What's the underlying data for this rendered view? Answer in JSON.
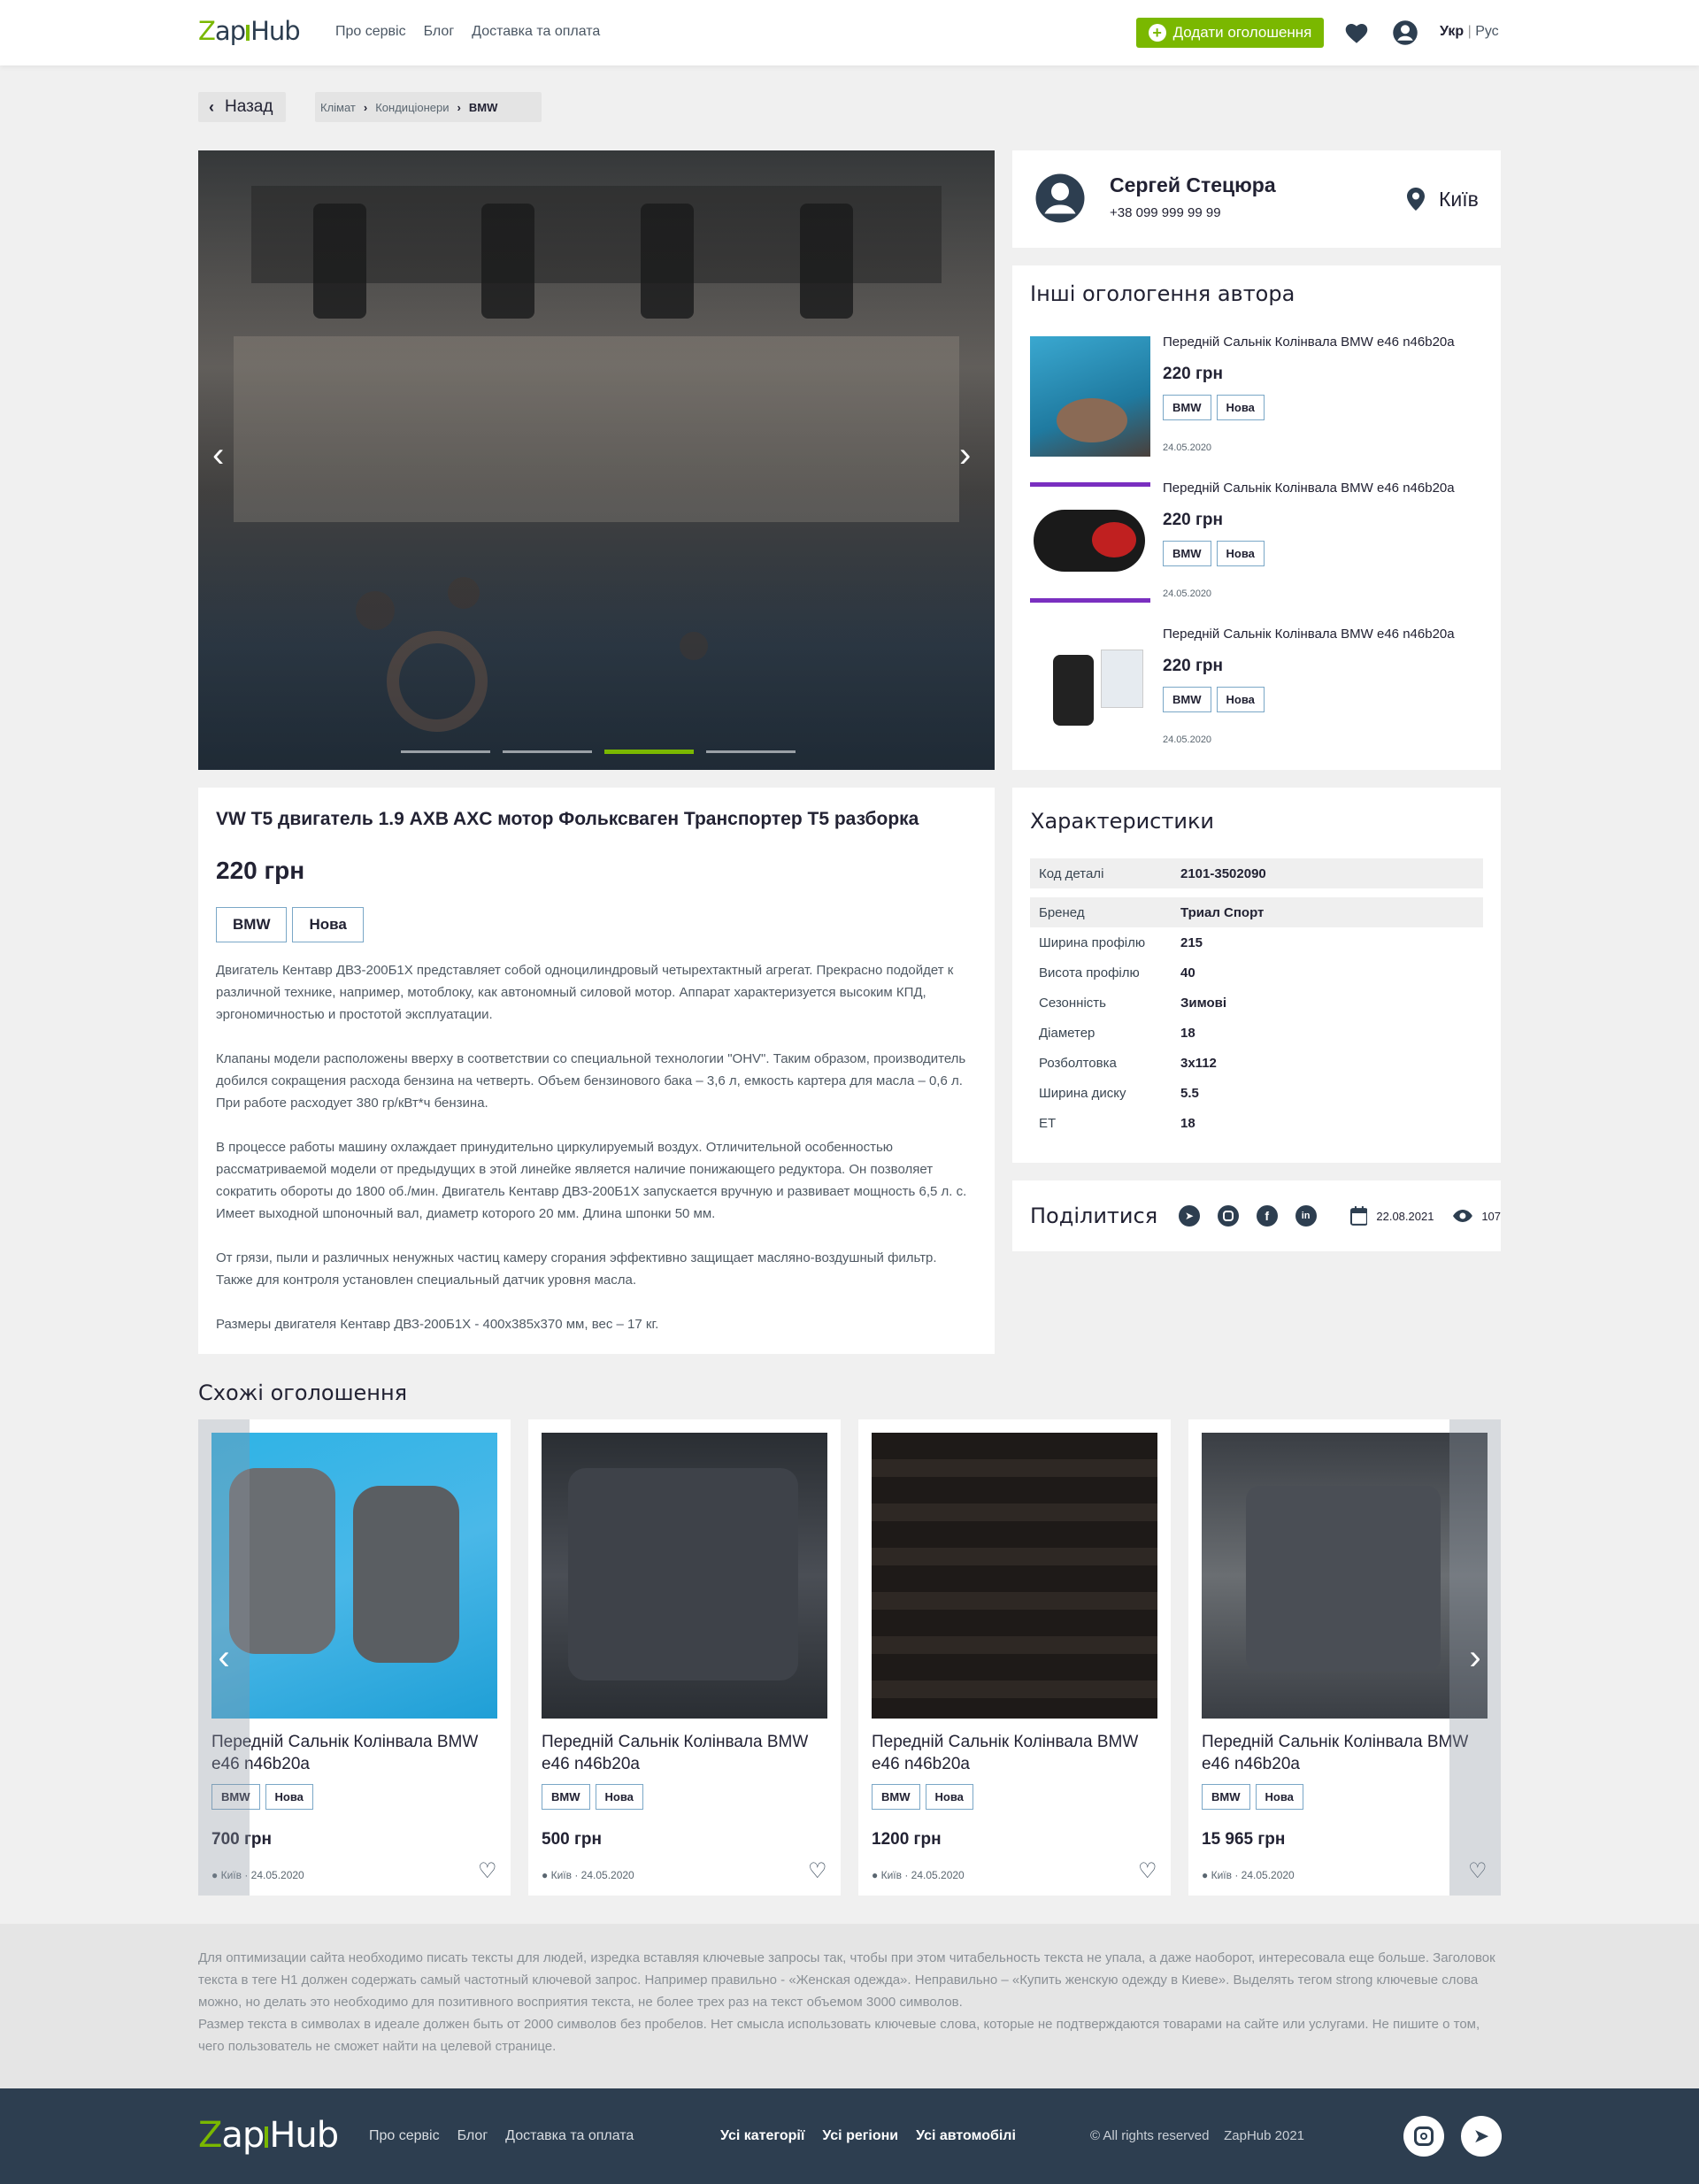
{
  "header": {
    "logo": "ZapHub",
    "nav": [
      "Про сервіс",
      "Блог",
      "Доставка та оплата"
    ],
    "add_button": "Додати оголошення",
    "lang_ukr": "Укр",
    "lang_rus": "Рус"
  },
  "breadcrumb": {
    "back": "Назад",
    "items": [
      "Клімат",
      "Кондиціонери",
      "BMW"
    ]
  },
  "gallery": {
    "slides": 4,
    "active_slide": 3
  },
  "seller": {
    "name": "Сергей Стецюра",
    "phone": "+38 099 999 99 99",
    "city": "Київ"
  },
  "other_ads": {
    "title": "Інші огологення автора",
    "items": [
      {
        "title": "Передній Сальнік Колінвала BMW e46 n46b20a",
        "price": "220 грн",
        "tags": [
          "BMW",
          "Нова"
        ],
        "date": "24.05.2020"
      },
      {
        "title": "Передній Сальнік Колінвала BMW e46 n46b20a",
        "price": "220 грн",
        "tags": [
          "BMW",
          "Нова"
        ],
        "date": "24.05.2020"
      },
      {
        "title": "Передній Сальнік Колінвала BMW e46 n46b20a",
        "price": "220 грн",
        "tags": [
          "BMW",
          "Нова"
        ],
        "date": "24.05.2020"
      }
    ]
  },
  "product": {
    "title": "VW T5 двигатель 1.9 AXB AXC мотор Фольксваген Транспортер Т5 разборка",
    "price": "220 грн",
    "tags": [
      "BMW",
      "Нова"
    ],
    "description": [
      "Двигатель Кентавр ДВЗ-200Б1Х представляет собой одноцилиндровый четырехтактный агрегат. Прекрасно подойдет к различной технике, например, мотоблоку, как автономный силовой мотор. Аппарат характеризуется высоким КПД, эргономичностью и простотой эксплуатации.",
      "Клапаны модели расположены вверху в соответствии со специальной технологии \"OHV\". Таким образом, производитель добился сокращения расхода бензина на четверть. Объем бензинового бака – 3,6 л, емкость картера для масла – 0,6 л. При работе расходует 380 гр/кВт*ч бензина.",
      "В процессе работы машину охлаждает принудительно циркулируемый воздух. Отличительной особенностью рассматриваемой модели от предыдущих в этой линейке является наличие понижающего редуктора. Он позволяет сократить обороты до 1800 об./мин. Двигатель Кентавр ДВЗ-200Б1Х запускается вручную и развивает мощность 6,5 л. с. Имеет выходной шпоночный вал, диаметр которого 20 мм. Длина шпонки 50 мм.",
      "От грязи, пыли и различных ненужных частиц камеру сгорания эффективно защищает масляно-воздушный фильтр. Также для контроля установлен специальный датчик уровня масла.",
      "Размеры двигателя Кентавр ДВЗ-200Б1Х - 400х385х370 мм, вес – 17 кг."
    ]
  },
  "specs": {
    "title": "Характеристики",
    "rows": [
      {
        "key": "Код деталі",
        "value": "2101-3502090"
      },
      {
        "key": "Бренед",
        "value": "Триал Спорт"
      },
      {
        "key": "Ширина профілю",
        "value": "215"
      },
      {
        "key": "Висота профілю",
        "value": "40"
      },
      {
        "key": "Сезонність",
        "value": "Зимові"
      },
      {
        "key": "Діаметер",
        "value": "18"
      },
      {
        "key": "Розболтовка",
        "value": "3х112"
      },
      {
        "key": "Ширина диску",
        "value": "5.5"
      },
      {
        "key": "ЕТ",
        "value": "18"
      }
    ]
  },
  "share": {
    "title": "Поділитися",
    "date": "22.08.2021",
    "views": "107"
  },
  "similar": {
    "title": "Схожі оголошення",
    "items": [
      {
        "title": "Передній Сальнік Колінвала BMW e46 n46b20a",
        "tags": [
          "BMW",
          "Нова"
        ],
        "price": "700 грн",
        "city": "Київ",
        "date": "24.05.2020"
      },
      {
        "title": "Передній Сальнік Колінвала BMW e46 n46b20a",
        "tags": [
          "BMW",
          "Нова"
        ],
        "price": "500 грн",
        "city": "Київ",
        "date": "24.05.2020"
      },
      {
        "title": "Передній Сальнік Колінвала BMW e46 n46b20a",
        "tags": [
          "BMW",
          "Нова"
        ],
        "price": "1200 грн",
        "city": "Київ",
        "date": "24.05.2020"
      },
      {
        "title": "Передній Сальнік Колінвала BMW e46 n46b20a",
        "tags": [
          "BMW",
          "Нова"
        ],
        "price": "15 965 грн",
        "city": "Київ",
        "date": "24.05.2020"
      }
    ]
  },
  "seo_text": [
    "Для оптимизации сайта необходимо писать тексты для людей, изредка вставляя ключевые запросы так, чтобы при этом читабельность текста не упала, а даже наоборот, интересовала еще больше. Заголовок текста в теге H1 должен содержать самый частотный ключевой запрос. Например правильно - «Женская одежда». Неправильно – «Купить женскую одежду в Киеве». Выделять тегом strong ключевые слова можно, но делать это необходимо для позитивного восприятия текста, не более трех раз на текст объемом 3000 символов.",
    "Размер текста в символах в идеале должен быть от 2000 символов без пробелов. Нет смысла использовать ключевые слова, которые не подтверждаются товарами на сайте или услугами. Не пишите о том, чего пользователь не сможет найти на целевой странице."
  ],
  "footer": {
    "logo": "ZapHub",
    "nav": [
      "Про сервіс",
      "Блог",
      "Доставка та оплата"
    ],
    "cats": [
      "Усі категорії",
      "Усі регіони",
      "Усі автомобілі"
    ],
    "rights": "© All rights reserved",
    "brand_year": "ZapHub 2021"
  },
  "colors": {
    "accent": "#7ab800",
    "dark": "#2d3e50",
    "tag_border": "#7aa7c7"
  }
}
